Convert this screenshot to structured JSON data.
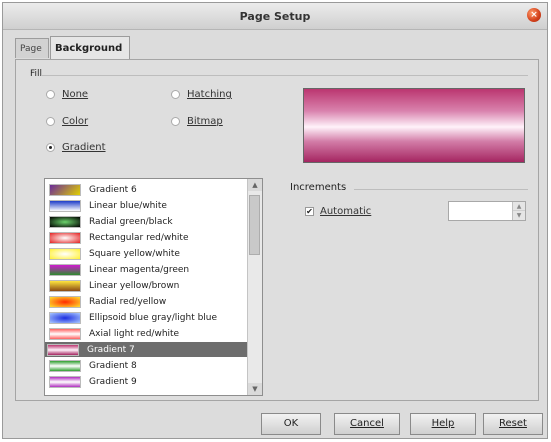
{
  "window": {
    "title": "Page Setup"
  },
  "tabs": [
    {
      "label": "Page",
      "active": false
    },
    {
      "label": "Background",
      "active": true
    }
  ],
  "fill": {
    "group_label": "Fill",
    "options": [
      {
        "label": "None",
        "selected": false
      },
      {
        "label": "Color",
        "selected": false
      },
      {
        "label": "Gradient",
        "selected": true
      },
      {
        "label": "Hatching",
        "selected": false
      },
      {
        "label": "Bitmap",
        "selected": false
      }
    ]
  },
  "gradients": {
    "items": [
      {
        "label": "Gradient 6",
        "swatch": "linear-gradient(135deg,#6a2a9a,#e0d000)"
      },
      {
        "label": "Linear blue/white",
        "swatch": "linear-gradient(#1e3cc8,#ffffff)"
      },
      {
        "label": "Radial green/black",
        "swatch": "radial-gradient(#6cd46c,#000000)"
      },
      {
        "label": "Rectangular red/white",
        "swatch": "radial-gradient(#ffffff,#e42020)"
      },
      {
        "label": "Square yellow/white",
        "swatch": "radial-gradient(#ffffff,#fff030)"
      },
      {
        "label": "Linear magenta/green",
        "swatch": "linear-gradient(#d01ad0,#2e8b2e)"
      },
      {
        "label": "Linear yellow/brown",
        "swatch": "linear-gradient(#ffe640,#8a4a14)"
      },
      {
        "label": "Radial red/yellow",
        "swatch": "radial-gradient(#ff2a00,#ffe230)"
      },
      {
        "label": "Ellipsoid blue gray/light blue",
        "swatch": "radial-gradient(#1e2ee0,#a8c8ff)"
      },
      {
        "label": "Axial light red/white",
        "swatch": "linear-gradient(#ff6060,#ffffff,#ff6060)"
      },
      {
        "label": "Gradient 7",
        "swatch": "linear-gradient(#bb3670,#fff2fa,#a52661)",
        "selected": true
      },
      {
        "label": "Gradient 8",
        "swatch": "linear-gradient(#2ea02e,#ffffff,#2ea02e)"
      },
      {
        "label": "Gradient 9",
        "swatch": "linear-gradient(#b030c0,#ffffff,#b030c0)"
      }
    ]
  },
  "increments": {
    "group_label": "Increments",
    "automatic_label": "Automatic",
    "automatic_checked": true,
    "value": ""
  },
  "buttons": {
    "ok": "OK",
    "cancel": "Cancel",
    "help": "Help",
    "reset": "Reset"
  }
}
